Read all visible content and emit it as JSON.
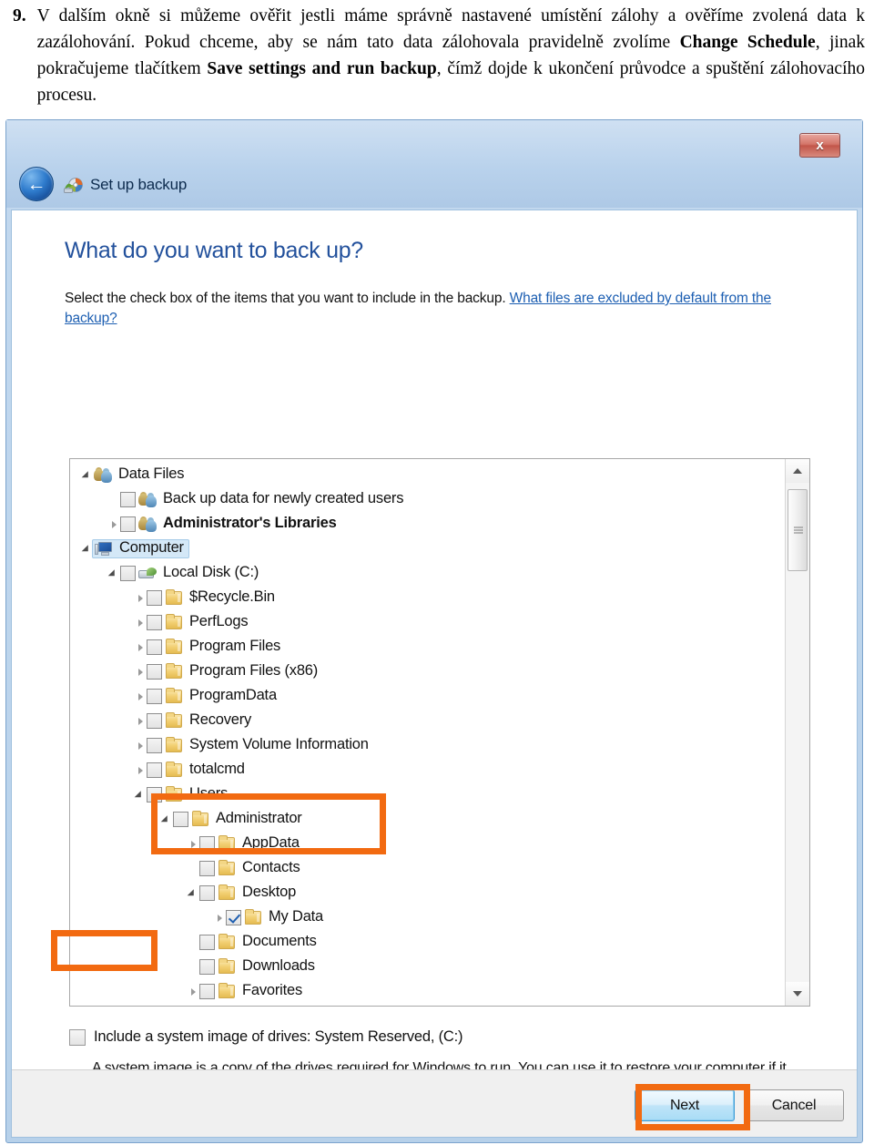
{
  "document": {
    "list_number": "9.",
    "paragraph_html": "V dalším okně si můžeme ověřit jestli máme správně nastavené umístění zálohy a ověříme zvolená data k zazálohování. Pokud chceme, aby se nám tato data zálohovala pravidelně zvolíme <b>Change Schedule</b>, jinak pokračujeme tlačítkem <b>Save settings and run backup</b>, čímž dojde k ukončení průvodce a spuštění zálohovacího procesu."
  },
  "window": {
    "breadcrumb": "Set up backup",
    "close_label": "x",
    "back_icon": "back-arrow-icon",
    "title_icon": "backup-disc-icon"
  },
  "page": {
    "heading": "What do you want to back up?",
    "instruction_prefix": "Select the check box of the items that you want to include in the backup. ",
    "instruction_link": "What files are excluded by default from the backup?"
  },
  "tree": {
    "items": [
      {
        "label": "Data Files",
        "indent": 0,
        "expander": "expanded",
        "checkbox": "none",
        "icon": "users-group-icon",
        "bold": false,
        "selected": false
      },
      {
        "label": "Back up data for newly created users",
        "indent": 1,
        "expander": "none",
        "checkbox": "unchecked",
        "icon": "users-group-icon",
        "bold": false,
        "selected": false
      },
      {
        "label": "Administrator's Libraries",
        "indent": 1,
        "expander": "collapsed",
        "checkbox": "unchecked",
        "icon": "users-group-icon",
        "bold": true,
        "selected": false
      },
      {
        "label": "Computer",
        "indent": 0,
        "expander": "expanded",
        "checkbox": "none",
        "icon": "computer-icon",
        "bold": false,
        "selected": true
      },
      {
        "label": "Local Disk (C:)",
        "indent": 1,
        "expander": "expanded",
        "checkbox": "unchecked",
        "icon": "hard-drive-icon",
        "bold": false,
        "selected": false
      },
      {
        "label": "$Recycle.Bin",
        "indent": 2,
        "expander": "collapsed",
        "checkbox": "unchecked",
        "icon": "folder-icon",
        "bold": false,
        "selected": false
      },
      {
        "label": "PerfLogs",
        "indent": 2,
        "expander": "collapsed",
        "checkbox": "unchecked",
        "icon": "folder-icon",
        "bold": false,
        "selected": false
      },
      {
        "label": "Program Files",
        "indent": 2,
        "expander": "collapsed",
        "checkbox": "unchecked",
        "icon": "folder-icon",
        "bold": false,
        "selected": false
      },
      {
        "label": "Program Files (x86)",
        "indent": 2,
        "expander": "collapsed",
        "checkbox": "unchecked",
        "icon": "folder-icon",
        "bold": false,
        "selected": false
      },
      {
        "label": "ProgramData",
        "indent": 2,
        "expander": "collapsed",
        "checkbox": "unchecked",
        "icon": "folder-icon",
        "bold": false,
        "selected": false
      },
      {
        "label": "Recovery",
        "indent": 2,
        "expander": "collapsed",
        "checkbox": "unchecked",
        "icon": "folder-icon",
        "bold": false,
        "selected": false
      },
      {
        "label": "System Volume Information",
        "indent": 2,
        "expander": "collapsed",
        "checkbox": "unchecked",
        "icon": "folder-icon",
        "bold": false,
        "selected": false
      },
      {
        "label": "totalcmd",
        "indent": 2,
        "expander": "collapsed",
        "checkbox": "unchecked",
        "icon": "folder-icon",
        "bold": false,
        "selected": false
      },
      {
        "label": "Users",
        "indent": 2,
        "expander": "expanded",
        "checkbox": "unchecked",
        "icon": "folder-icon",
        "bold": false,
        "selected": false
      },
      {
        "label": "Administrator",
        "indent": 3,
        "expander": "expanded",
        "checkbox": "unchecked",
        "icon": "folder-icon",
        "bold": false,
        "selected": false
      },
      {
        "label": "AppData",
        "indent": 4,
        "expander": "collapsed",
        "checkbox": "unchecked",
        "icon": "folder-icon",
        "bold": false,
        "selected": false
      },
      {
        "label": "Contacts",
        "indent": 4,
        "expander": "none",
        "checkbox": "unchecked",
        "icon": "folder-icon",
        "bold": false,
        "selected": false
      },
      {
        "label": "Desktop",
        "indent": 4,
        "expander": "expanded",
        "checkbox": "unchecked",
        "icon": "folder-icon",
        "bold": false,
        "selected": false
      },
      {
        "label": "My Data",
        "indent": 5,
        "expander": "collapsed",
        "checkbox": "checked",
        "icon": "folder-icon",
        "bold": false,
        "selected": false
      },
      {
        "label": "Documents",
        "indent": 4,
        "expander": "none",
        "checkbox": "unchecked",
        "icon": "folder-icon",
        "bold": false,
        "selected": false
      },
      {
        "label": "Downloads",
        "indent": 4,
        "expander": "none",
        "checkbox": "unchecked",
        "icon": "folder-icon",
        "bold": false,
        "selected": false
      },
      {
        "label": "Favorites",
        "indent": 4,
        "expander": "collapsed",
        "checkbox": "unchecked",
        "icon": "folder-icon",
        "bold": false,
        "selected": false
      }
    ],
    "scrollbar": {
      "up_arrow": "scroll-up-icon",
      "down_arrow": "scroll-down-icon"
    }
  },
  "system_image": {
    "checkbox_state": "unchecked",
    "label": "Include a system image of drives: System Reserved, (C:)",
    "description": "A system image is a copy of the drives required for Windows to run. You can use it to restore your computer if it stops working."
  },
  "buttons": {
    "next": "Next",
    "cancel": "Cancel"
  },
  "annotations": {
    "color": "#f26a11",
    "targets": [
      "my-data-checkbox",
      "include-system-image-checkbox",
      "next-button"
    ]
  }
}
